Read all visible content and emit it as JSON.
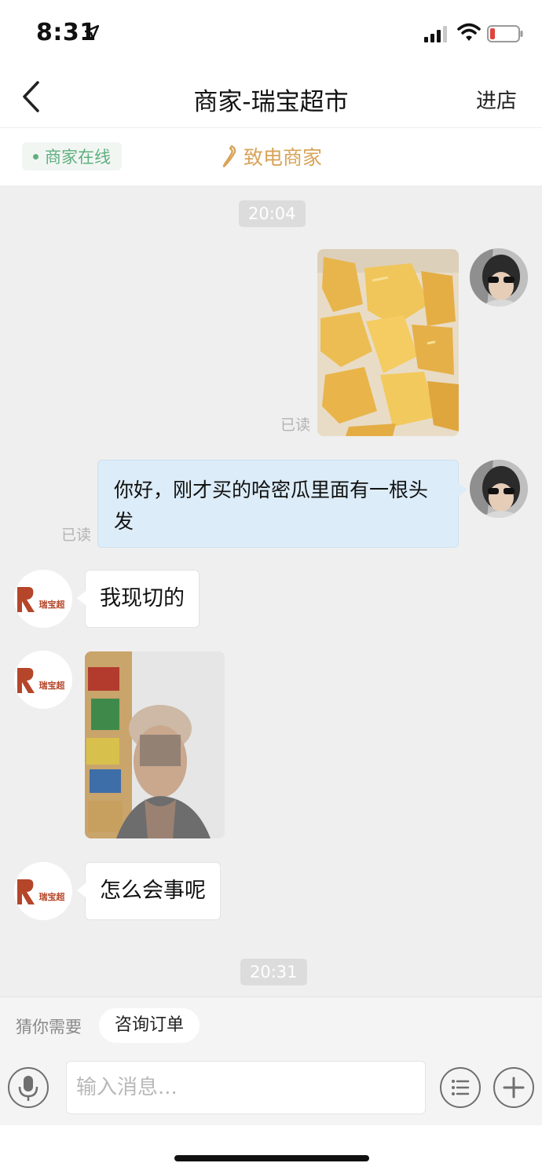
{
  "status_bar": {
    "time": "8:31"
  },
  "nav": {
    "title": "商家-瑞宝超市",
    "enter_store": "进店"
  },
  "merchant": {
    "online_label": "商家在线",
    "call_label": "致电商家"
  },
  "chat": {
    "time_1": "20:04",
    "read_label_1": "已读",
    "user_text_message": "你好，刚才买的哈密瓜里面有一根头发",
    "read_label_2": "已读",
    "shop_reply_1": "我现切的",
    "shop_reply_2": "怎么会事呢",
    "time_2": "20:31",
    "shop_logo_text": "瑞宝超"
  },
  "suggest": {
    "label": "猜你需要",
    "chip": "咨询订单"
  },
  "input": {
    "placeholder": "输入消息..."
  },
  "colors": {
    "online_green": "#5fb07f",
    "call_gold": "#d8a45a",
    "user_bubble": "#dcecf8",
    "chat_background": "#efefef",
    "logo_red": "#b5462a"
  }
}
